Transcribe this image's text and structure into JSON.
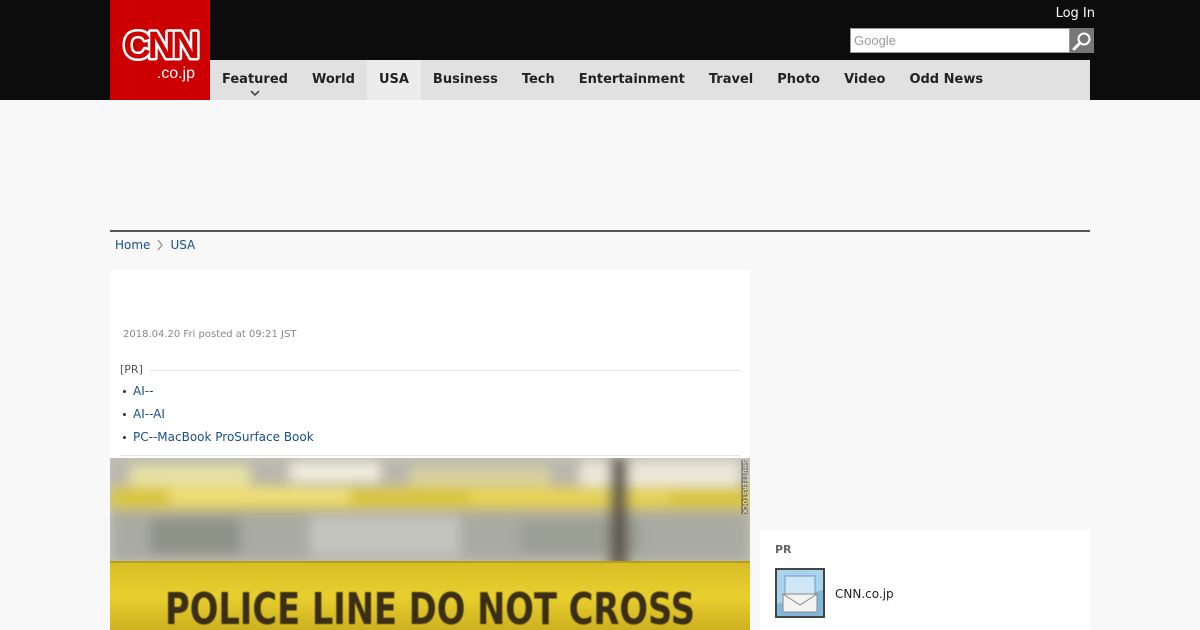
{
  "header": {
    "logo_text": "CNN",
    "logo_subtext": ".co.jp",
    "login_label": "Log In",
    "search": {
      "placeholder": "Google",
      "value": ""
    }
  },
  "nav": {
    "items": [
      {
        "label": "Featured"
      },
      {
        "label": "World"
      },
      {
        "label": "USA"
      },
      {
        "label": "Business"
      },
      {
        "label": "Tech"
      },
      {
        "label": "Entertainment"
      },
      {
        "label": "Travel"
      },
      {
        "label": "Photo"
      },
      {
        "label": "Video"
      },
      {
        "label": "Odd News"
      }
    ],
    "active": "USA"
  },
  "breadcrumb": {
    "home": "Home",
    "current": "USA"
  },
  "article": {
    "posted": "2018.04.20 Fri posted at 09:21 JST",
    "pr_label": "[PR]",
    "pr_links": [
      "AI--",
      "AI--AI",
      "PC--MacBook ProSurface Book"
    ],
    "image_credit": "SHUTTERSTOCK",
    "image_tape_text": "POLICE LINE DO NOT CROSS"
  },
  "sidebar": {
    "pr_label": "PR",
    "link_text": "CNN.co.jp"
  },
  "colors": {
    "brand_red": "#cc0000",
    "topbar": "#0c0c0c",
    "nav_bg": "#e1e1e1",
    "link": "#1a4f8b",
    "tape_yellow": "#e8cf2e"
  },
  "icons": {
    "search": "search-icon",
    "nav_chevron": "chevron-down-icon",
    "breadcrumb_separator": "chevron-right-icon",
    "sidebar_thumb": "mail-thumbnail-icon"
  }
}
